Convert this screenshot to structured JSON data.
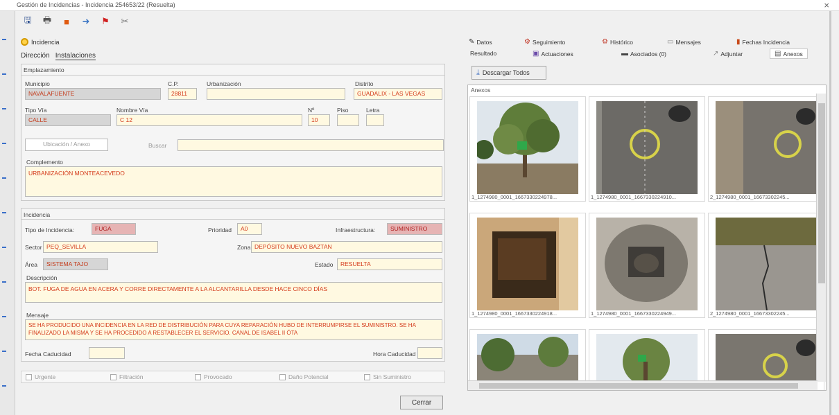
{
  "window": {
    "title": "Gestión de Incidencias - Incidencia 254653/22 (Resuelta)",
    "close_symbol": "×"
  },
  "toolbar": {
    "buttons": [
      {
        "name": "save-icon",
        "glyph": "🖫"
      },
      {
        "name": "print-icon",
        "glyph": "🖶"
      },
      {
        "name": "stop-icon",
        "glyph": "■"
      },
      {
        "name": "arrow-icon",
        "glyph": "➜"
      },
      {
        "name": "flag-icon",
        "glyph": "⚑"
      },
      {
        "name": "tools-icon",
        "glyph": "✂"
      }
    ]
  },
  "header": {
    "label": "Incidencia"
  },
  "left_tabs": {
    "tab1": "Dirección",
    "tab2": "Instalaciones"
  },
  "location": {
    "section": "Emplazamiento",
    "municipio_label": "Municipio",
    "municipio": "NAVALAFUENTE",
    "cp_label": "C.P.",
    "cp": "28811",
    "urbanizacion_label": "Urbanización",
    "urbanizacion": "",
    "distrito_label": "Distrito",
    "distrito": "GUADALIX - LAS VEGAS",
    "tipo_via_label": "Tipo Vía",
    "tipo_via": "CALLE",
    "nombre_via_label": "Nombre Vía",
    "nombre_via": "C 12",
    "num_label": "Nº",
    "num": "10",
    "piso_label": "Piso",
    "piso": "",
    "letra_label": "Letra",
    "letra": "",
    "btn_ubicacion": "Ubicación",
    "btn_anexo": "Anexo",
    "observ_label": "Buscar",
    "observ": "",
    "complemento_label": "Complemento",
    "complemento": "URBANIZACIÓN MONTEACEVEDO"
  },
  "incident": {
    "section": "Incidencia",
    "tipo_label": "Tipo de Incidencia:",
    "tipo": "FUGA",
    "prioridad_label": "Prioridad",
    "prioridad": "A0",
    "infra_label": "Infraestructura:",
    "infra": "SUMINISTRO",
    "sector_label": "Sector",
    "sector": "PEQ_SEVILLA",
    "zona_label": "Zona",
    "zona": "DEPÓSITO NUEVO BAZTAN",
    "area_label": "Área",
    "area": "SISTEMA TAJO",
    "estado_label": "Estado",
    "estado": "RESUELTA",
    "descripcion_label": "Descripción",
    "descripcion": "BOT. FUGA DE AGUA EN ACERA Y CORRE DIRECTAMENTE A LA ALCANTARILLA DESDE HACE CINCO DÍAS",
    "mensaje_label": "Mensaje",
    "mensaje": "SE HA PRODUCIDO UNA INCIDENCIA EN LA RED DE DISTRIBUCIÓN PARA CUYA REPARACIÓN HUBO DE INTERRUMPIRSE EL SUMINISTRO. SE HA FINALIZADO LA MISMA Y SE HA PROCEDIDO A RESTABLECER EL SERVICIO. CANAL DE ISABEL II ÓTA",
    "fecha_cad_label": "Fecha Caducidad",
    "fecha_cad": "",
    "hora_cad_label": "Hora Caducidad",
    "hora_cad": ""
  },
  "checkboxes": [
    "Urgente",
    "Filtración",
    "Provocado",
    "Daño Potencial",
    "Sin Suministro"
  ],
  "footer": {
    "close_button": "Cerrar"
  },
  "right_tabs": {
    "row1": [
      {
        "label": "Datos",
        "icon": "pencil-icon",
        "glyph": "✎"
      },
      {
        "label": "Seguimiento",
        "icon": "gear-icon",
        "glyph": "⚙"
      },
      {
        "label": "Histórico",
        "icon": "history-icon",
        "glyph": "⚙"
      },
      {
        "label": "Mensajes",
        "icon": "message-icon",
        "glyph": "▭"
      },
      {
        "label": "Fechas Incidencia",
        "icon": "chart-icon",
        "glyph": "▮"
      }
    ],
    "row2": [
      {
        "label": "Resultado",
        "icon": "",
        "glyph": ""
      },
      {
        "label": "Actuaciones",
        "icon": "actions-icon",
        "glyph": "▣"
      },
      {
        "label": "Asociados (0)",
        "icon": "link-icon",
        "glyph": "▬"
      },
      {
        "label": "Adjuntar",
        "icon": "attach-icon",
        "glyph": "↗"
      },
      {
        "label": "Anexos",
        "icon": "document-icon",
        "glyph": "▤"
      }
    ]
  },
  "gallery": {
    "download_all": "Descargar Todos",
    "header": "Anexos",
    "items": [
      {
        "caption": "1_1274980_0001_1667330224978..."
      },
      {
        "caption": "1_1274980_0001_1667330224910..."
      },
      {
        "caption": "2_1274980_0001_16673302245..."
      },
      {
        "caption": "1_1274980_0001_1667330224918..."
      },
      {
        "caption": "1_1274980_0001_1667330224949..."
      },
      {
        "caption": "2_1274980_0001_16673302245..."
      },
      {
        "caption": ""
      },
      {
        "caption": ""
      },
      {
        "caption": ""
      }
    ]
  }
}
